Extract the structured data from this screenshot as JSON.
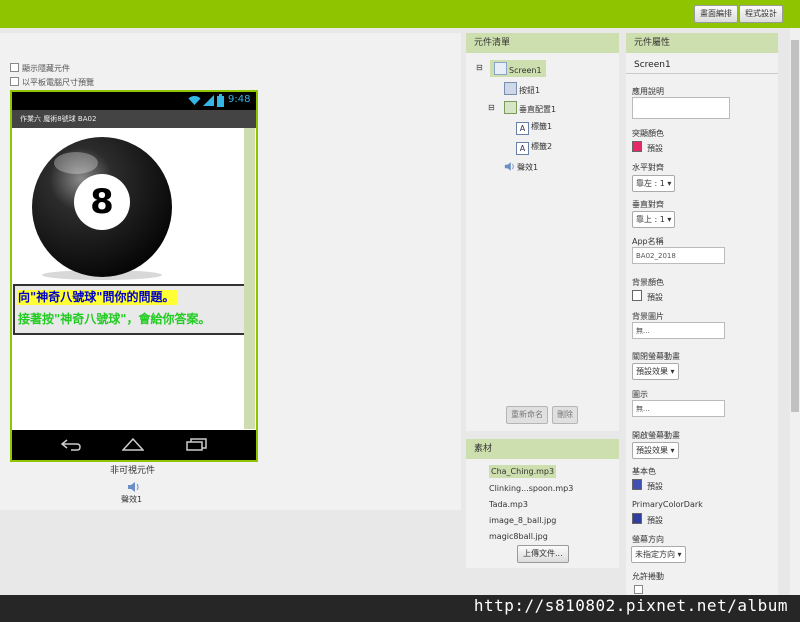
{
  "topbar": {
    "designer_label": "畫面編排",
    "blocks_label": "程式設計"
  },
  "viewer": {
    "checkbox_hidden": "顯示隱藏元件",
    "checkbox_tablet": "以平板電腦尺寸預覽",
    "status_time": "9:48",
    "app_title": "作業六 魔術8號球 BA02",
    "eight_ball_text": "8",
    "label1": "向\"神奇八號球\"問你的問題。",
    "label2": "接著按\"神奇八號球\"，會給你答案。",
    "nonvisible_title": "非可視元件",
    "nonvisible_item": "聲效1"
  },
  "components": {
    "header": "元件清單",
    "tree": [
      "Screen1",
      "按鈕1",
      "垂直配置1",
      "標籤1",
      "標籤2",
      "聲效1"
    ],
    "rename_label": "重新命名",
    "delete_label": "刪除"
  },
  "media": {
    "header": "素材",
    "files": [
      "Cha_Ching.mp3",
      "Clinking...spoon.mp3",
      "Tada.mp3",
      "image_8_ball.jpg",
      "magic8ball.jpg"
    ],
    "upload_label": "上傳文件..."
  },
  "properties": {
    "header": "元件屬性",
    "selected": "Screen1",
    "about_label": "應用說明",
    "accent_label": "突顯顏色",
    "accent_value": "預設",
    "accent_color": "#e8276b",
    "align_h_label": "水平對齊",
    "align_h_value": "靠左 : 1",
    "align_v_label": "垂直對齊",
    "align_v_value": "靠上 : 1",
    "appname_label": "App名稱",
    "appname_value": "BA02_2018",
    "bgcolor_label": "背景顏色",
    "bgcolor_value": "預設",
    "bgcolor_color": "#ffffff",
    "bgimage_label": "背景圖片",
    "bgimage_value": "無...",
    "close_anim_label": "關閉螢幕動畫",
    "close_anim_value": "預設效果",
    "icon_label": "圖示",
    "icon_value": "無...",
    "open_anim_label": "開啟螢幕動畫",
    "open_anim_value": "預設效果",
    "primary_label": "基本色",
    "primary_value": "預設",
    "primary_color": "#3f51b5",
    "primary_dark_label": "PrimaryColorDark",
    "primary_dark_value": "預設",
    "primary_dark_color": "#303f9f",
    "orientation_label": "螢幕方向",
    "orientation_value": "未指定方向",
    "scrollable_label": "允許捲動"
  },
  "watermark": "http://s810802.pixnet.net/album"
}
